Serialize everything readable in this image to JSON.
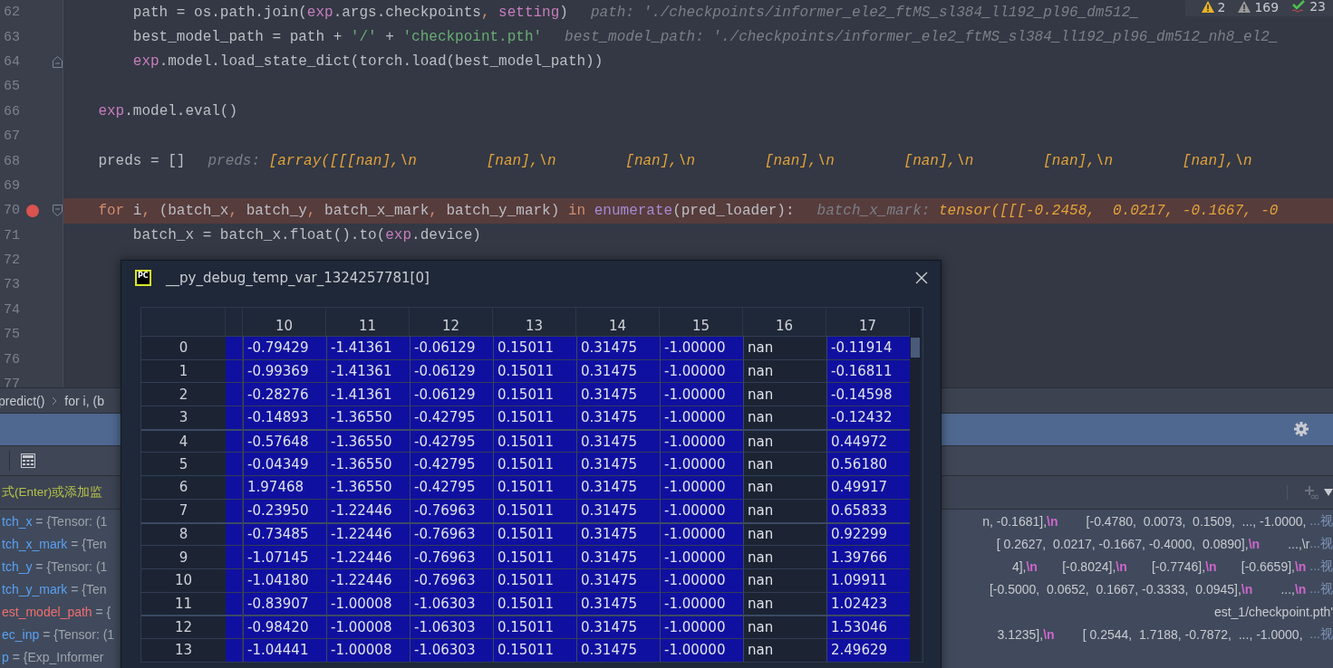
{
  "status_indicators": [
    {
      "kind": "warning",
      "count": "2"
    },
    {
      "kind": "weak-warning",
      "count": "169"
    },
    {
      "kind": "typo",
      "count": "23"
    }
  ],
  "code_lines": [
    {
      "number": "62",
      "breakpoint": false,
      "segments": [
        {
          "text": "        path = os.path.join(",
          "kind": "plain"
        },
        {
          "text": "exp",
          "kind": "self"
        },
        {
          "text": ".args.checkpoints",
          "kind": "plain"
        },
        {
          "text": ", ",
          "kind": "kw"
        },
        {
          "text": "setting",
          "kind": "self"
        },
        {
          "text": ")",
          "kind": "plain"
        }
      ],
      "hint": {
        "label": "path:",
        "value": "'./checkpoints/informer_ele2_ftMS_sl384_ll192_pl96_dm512_",
        "kind": "str"
      }
    },
    {
      "number": "63",
      "breakpoint": false,
      "segments": [
        {
          "text": "        best_model_path = path + ",
          "kind": "plain"
        },
        {
          "text": "'/'",
          "kind": "str"
        },
        {
          "text": " + ",
          "kind": "plain"
        },
        {
          "text": "'checkpoint.pth'",
          "kind": "str"
        }
      ],
      "hint": {
        "label": "best_model_path:",
        "value": "'./checkpoints/informer_ele2_ftMS_sl384_ll192_pl96_dm512_nh8_el2_",
        "kind": "str"
      }
    },
    {
      "number": "64",
      "breakpoint": false,
      "fold_close": true,
      "segments": [
        {
          "text": "        exp",
          "kind": "self"
        },
        {
          "text": ".model.load_state_dict(torch.load(best_model_path))",
          "kind": "plain"
        }
      ]
    },
    {
      "number": "65",
      "breakpoint": false
    },
    {
      "number": "66",
      "breakpoint": false,
      "segments": [
        {
          "text": "    exp",
          "kind": "self"
        },
        {
          "text": ".model.eval()",
          "kind": "plain"
        }
      ]
    },
    {
      "number": "67",
      "breakpoint": false
    },
    {
      "number": "68",
      "breakpoint": false,
      "segments": [
        {
          "text": "    preds = []",
          "kind": "plain"
        }
      ],
      "hint": {
        "label": "preds:",
        "value": "[array([[[nan],\\n        [nan],\\n        [nan],\\n        [nan],\\n        [nan],\\n        [nan],\\n        [nan],\\n",
        "kind": "obj"
      }
    },
    {
      "number": "69",
      "breakpoint": false
    },
    {
      "number": "70",
      "breakpoint": true,
      "fold_open": true,
      "segments": [
        {
          "text": "    for",
          "kind": "kw"
        },
        {
          "text": " i",
          "kind": "plain"
        },
        {
          "text": ", ",
          "kind": "kw"
        },
        {
          "text": "(batch_x",
          "kind": "plain"
        },
        {
          "text": ", ",
          "kind": "kw"
        },
        {
          "text": "batch_y",
          "kind": "plain"
        },
        {
          "text": ", ",
          "kind": "kw"
        },
        {
          "text": "batch_x_mark",
          "kind": "plain"
        },
        {
          "text": ", ",
          "kind": "kw"
        },
        {
          "text": "batch_y_mark) ",
          "kind": "plain"
        },
        {
          "text": "in ",
          "kind": "kw"
        },
        {
          "text": "enumerate",
          "kind": "fn"
        },
        {
          "text": "(pred_loader):",
          "kind": "plain"
        }
      ],
      "hint": {
        "label": "batch_x_mark:",
        "value": "tensor([[[-0.2458,  0.0217, -0.1667, -0",
        "kind": "obj"
      }
    },
    {
      "number": "71",
      "breakpoint": false,
      "segments": [
        {
          "text": "        batch_x = batch_x.float().to(",
          "kind": "plain"
        },
        {
          "text": "exp",
          "kind": "self"
        },
        {
          "text": ".device)",
          "kind": "plain"
        }
      ]
    },
    {
      "number": "72",
      "breakpoint": false
    },
    {
      "number": "73",
      "breakpoint": false
    },
    {
      "number": "74",
      "breakpoint": false
    },
    {
      "number": "75",
      "breakpoint": false
    },
    {
      "number": "76",
      "breakpoint": false
    },
    {
      "number": "77",
      "breakpoint": false
    }
  ],
  "breadcrumbs": [
    "predict()",
    "for i, (b"
  ],
  "evaluate_field": {
    "placeholder": "式(Enter)或添加监"
  },
  "variables": [
    {
      "name": "tch_x",
      "value": "= {Tensor: (1",
      "changed": false,
      "tail": "n, -0.1681],\\n        [-0.4780,  0.0073,  0.1509,  ..., -1.0000, ",
      "view": "...视"
    },
    {
      "name": "tch_x_mark",
      "value": "= {Ten",
      "changed": false,
      "tail": "[ 0.2627,  0.0217, -0.1667, -0.4000,  0.0890],\\n        ...,\\r",
      "view": "...视"
    },
    {
      "name": "tch_y",
      "value": "= {Tensor: (1",
      "changed": false,
      "tail": "4],\\n       [-0.8024],\\n       [-0.7746],\\n       [-0.6659],\\n ",
      "view": "...视"
    },
    {
      "name": "tch_y_mark",
      "value": "= {Ten",
      "changed": false,
      "tail": "[-0.5000,  0.0652,  0.1667, -0.3333,  0.0945],\\n        ...,\\n ",
      "view": "...视"
    },
    {
      "name": "est_model_path",
      "value": "= {",
      "changed": true,
      "tail": "est_1/checkpoint.pth'"
    },
    {
      "name": "ec_inp",
      "value": "= {Tensor: (1",
      "changed": false,
      "tail": "3.1235],\\n        [ 0.2544,  1.7188, -0.7872,  ..., -1.0000,  ",
      "view": "...视"
    },
    {
      "name": "p",
      "value": "= {Exp_Informer",
      "changed": false
    }
  ],
  "dialog": {
    "app_icon_text": "PC",
    "title": "__py_debug_temp_var_1324257781[0]",
    "columns": [
      {
        "label": "10",
        "colored": true
      },
      {
        "label": "11",
        "colored": true
      },
      {
        "label": "12",
        "colored": true
      },
      {
        "label": "13",
        "colored": true
      },
      {
        "label": "14",
        "colored": true
      },
      {
        "label": "15",
        "colored": true
      },
      {
        "label": "16",
        "colored": false
      },
      {
        "label": "17",
        "colored": true
      }
    ],
    "rows": [
      {
        "index": "0",
        "cells": [
          "-0.79429",
          "-1.41361",
          "-0.06129",
          "0.15011",
          "0.31475",
          "-1.00000",
          "nan",
          "-0.11914"
        ]
      },
      {
        "index": "1",
        "cells": [
          "-0.99369",
          "-1.41361",
          "-0.06129",
          "0.15011",
          "0.31475",
          "-1.00000",
          "nan",
          "-0.16811"
        ]
      },
      {
        "index": "2",
        "cells": [
          "-0.28276",
          "-1.41361",
          "-0.06129",
          "0.15011",
          "0.31475",
          "-1.00000",
          "nan",
          "-0.14598"
        ]
      },
      {
        "index": "3",
        "cells": [
          "-0.14893",
          "-1.36550",
          "-0.42795",
          "0.15011",
          "0.31475",
          "-1.00000",
          "nan",
          "-0.12432"
        ]
      },
      {
        "index": "4",
        "cells": [
          "-0.57648",
          "-1.36550",
          "-0.42795",
          "0.15011",
          "0.31475",
          "-1.00000",
          "nan",
          "0.44972"
        ]
      },
      {
        "index": "5",
        "cells": [
          "-0.04349",
          "-1.36550",
          "-0.42795",
          "0.15011",
          "0.31475",
          "-1.00000",
          "nan",
          "0.56180"
        ]
      },
      {
        "index": "6",
        "cells": [
          "1.97468",
          "-1.36550",
          "-0.42795",
          "0.15011",
          "0.31475",
          "-1.00000",
          "nan",
          "0.49917"
        ]
      },
      {
        "index": "7",
        "cells": [
          "-0.23950",
          "-1.22446",
          "-0.76963",
          "0.15011",
          "0.31475",
          "-1.00000",
          "nan",
          "0.65833"
        ]
      },
      {
        "index": "8",
        "cells": [
          "-0.73485",
          "-1.22446",
          "-0.76963",
          "0.15011",
          "0.31475",
          "-1.00000",
          "nan",
          "0.92299"
        ]
      },
      {
        "index": "9",
        "cells": [
          "-1.07145",
          "-1.22446",
          "-0.76963",
          "0.15011",
          "0.31475",
          "-1.00000",
          "nan",
          "1.39766"
        ]
      },
      {
        "index": "10",
        "cells": [
          "-1.04180",
          "-1.22446",
          "-0.76963",
          "0.15011",
          "0.31475",
          "-1.00000",
          "nan",
          "1.09911"
        ]
      },
      {
        "index": "11",
        "cells": [
          "-0.83907",
          "-1.00008",
          "-1.06303",
          "0.15011",
          "0.31475",
          "-1.00000",
          "nan",
          "1.02423"
        ]
      },
      {
        "index": "12",
        "cells": [
          "-0.98420",
          "-1.00008",
          "-1.06303",
          "0.15011",
          "0.31475",
          "-1.00000",
          "nan",
          "1.53046"
        ]
      },
      {
        "index": "13",
        "cells": [
          "-1.04441",
          "-1.00008",
          "-1.06303",
          "0.15011",
          "0.31475",
          "-1.00000",
          "nan",
          "2.49629"
        ]
      }
    ]
  }
}
